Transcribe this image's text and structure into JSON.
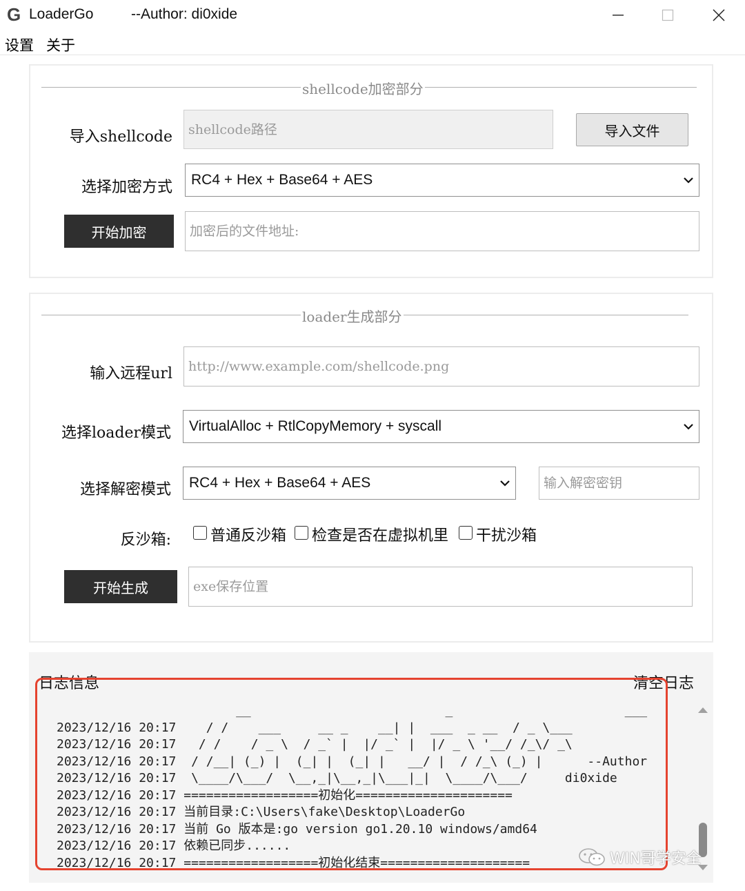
{
  "window": {
    "logo_letter": "G",
    "title": "LoaderGo",
    "author": "--Author: di0xide"
  },
  "menu": {
    "settings": "设置",
    "about": "关于"
  },
  "encrypt_section": {
    "legend": "shellcode加密部分",
    "import_label": "导入shellcode",
    "path_placeholder": "shellcode路径",
    "import_button": "导入文件",
    "method_label": "选择加密方式",
    "method_selected": "RC4 + Hex + Base64 + AES",
    "start_button": "开始加密",
    "output_placeholder": "加密后的文件地址:"
  },
  "loader_section": {
    "legend": "loader生成部分",
    "url_label": "输入远程url",
    "url_placeholder": "http://www.example.com/shellcode.png",
    "mode_label": "选择loader模式",
    "mode_selected": "VirtualAlloc + RtlCopyMemory + syscall",
    "decrypt_label": "选择解密模式",
    "decrypt_selected": "RC4 + Hex + Base64 + AES",
    "key_placeholder": "输入解密密钥",
    "sandbox_label": "反沙箱:",
    "sandbox_options": [
      "普通反沙箱",
      "检查是否在虚拟机里",
      "干扰沙箱"
    ],
    "generate_button": "开始生成",
    "save_placeholder": "exe保存位置"
  },
  "log": {
    "title": "日志信息",
    "clear_label": "清空日志",
    "text": "                        __                          _                       ___\n2023/12/16 20:17    / /    ___     __ _    __| |  ___  _ __  / _ \\___\n2023/12/16 20:17   / /    / _ \\  / _` |  |/ _` |  |/ _ \\ '__/ /_\\/ _\\\n2023/12/16 20:17  / /__| (_) |  (_| |  (_| |   __/ |  / /_\\ (_) |      --Author\n2023/12/16 20:17  \\____/\\___/  \\__,_|\\__,_|\\___|_|  \\____/\\___/     di0xide\n2023/12/16 20:17 ==================初始化=====================\n2023/12/16 20:17 当前目录:C:\\Users\\fake\\Desktop\\LoaderGo\n2023/12/16 20:17 当前 Go 版本是:go version go1.20.10 windows/amd64\n2023/12/16 20:17 依赖已同步......\n2023/12/16 20:17 ==================初始化结束===================="
  },
  "watermark": "WIN哥学安全"
}
